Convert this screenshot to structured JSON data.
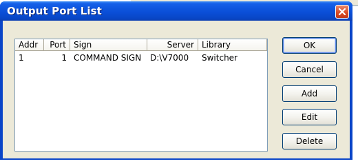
{
  "window": {
    "title": "Output Port List"
  },
  "list": {
    "columns": [
      "Addr",
      "Port",
      "Sign",
      "Server",
      "Library"
    ],
    "rows": [
      {
        "addr": "1",
        "port": "1",
        "sign": "COMMAND SIGN",
        "server": "D:\\V7000",
        "library": "Switcher"
      }
    ]
  },
  "buttons": {
    "ok": "OK",
    "cancel": "Cancel",
    "add": "Add",
    "edit": "Edit",
    "delete": "Delete"
  },
  "colors": {
    "titlebar": "#0a4fd8",
    "close": "#d84a24",
    "dialog_bg": "#ece9d8"
  },
  "icons": {
    "close": "close-icon"
  }
}
